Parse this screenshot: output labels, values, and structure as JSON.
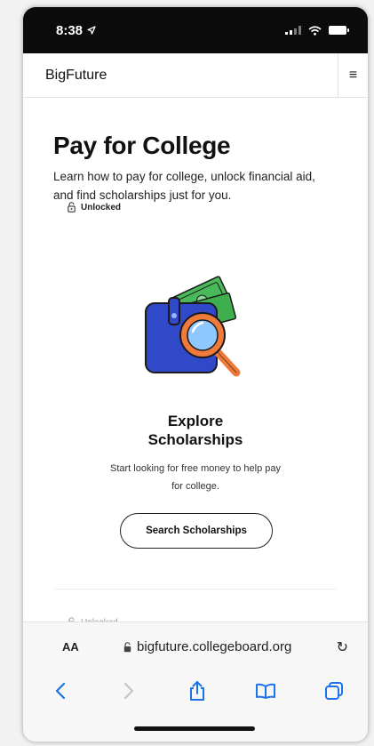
{
  "status_bar": {
    "time": "8:38"
  },
  "header": {
    "brand": "BigFuture"
  },
  "main": {
    "title": "Pay for College",
    "subtitle": "Learn how to pay for college, unlock financial aid, and find scholarships just for you."
  },
  "card": {
    "badge": "Unlocked",
    "title_line1": "Explore",
    "title_line2": "Scholarships",
    "description": "Start looking for free money to help pay for college.",
    "button_label": "Search Scholarships"
  },
  "next_card": {
    "badge": "Unlocked"
  },
  "browser": {
    "aa_label": "AA",
    "url": "bigfuture.collegeboard.org"
  },
  "colors": {
    "accent_blue": "#1a73e8",
    "wallet_blue": "#2f49c8",
    "money_green": "#3fae4f",
    "magnifier_orange": "#f07a3a"
  },
  "icons": [
    "location-arrow-icon",
    "signal-icon",
    "wifi-icon",
    "battery-icon",
    "menu-icon",
    "lock-icon",
    "wallet-illustration",
    "lock-icon",
    "reload-icon",
    "back-icon",
    "forward-icon",
    "share-icon",
    "bookmarks-icon",
    "tabs-icon"
  ]
}
